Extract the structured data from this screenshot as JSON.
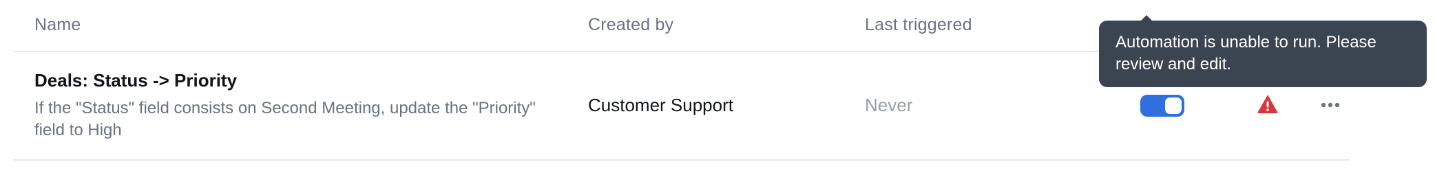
{
  "table": {
    "headers": {
      "name": "Name",
      "created_by": "Created by",
      "last_triggered": "Last triggered"
    },
    "rows": [
      {
        "title": "Deals: Status -> Priority",
        "description": "If the \"Status\" field consists on Second Meeting, update the \"Priority\" field to High",
        "created_by": "Customer Support",
        "last_triggered": "Never",
        "enabled": true,
        "status_icon": "warning-icon",
        "actions_icon": "more-horizontal-icon"
      }
    ]
  },
  "tooltip": {
    "text": "Automation is unable to run. Please review and edit."
  },
  "colors": {
    "toggle_on": "#2f6fde",
    "warning": "#d9383a",
    "tooltip_bg": "#3b4451",
    "muted_text": "#6b7280"
  }
}
